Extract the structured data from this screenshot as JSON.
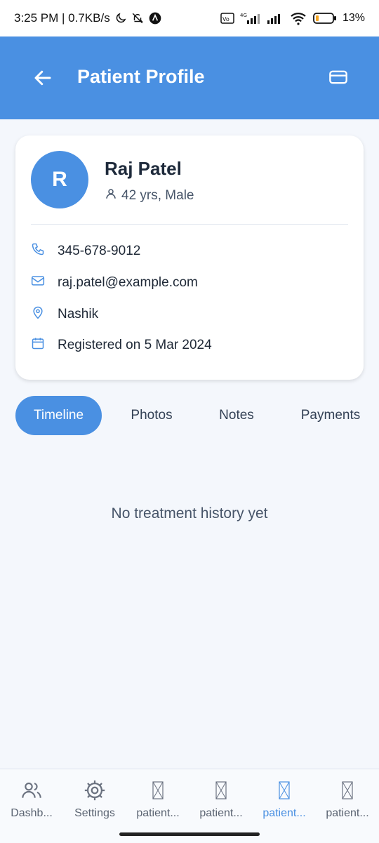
{
  "status_bar": {
    "time": "3:25 PM | 0.7KB/s",
    "network": "4G",
    "battery": "13%"
  },
  "app_bar": {
    "title": "Patient Profile"
  },
  "patient": {
    "initial": "R",
    "name": "Raj Patel",
    "meta": "42 yrs, Male",
    "phone": "345-678-9012",
    "email": "raj.patel@example.com",
    "location": "Nashik",
    "registered": "Registered on 5 Mar 2024"
  },
  "tabs": [
    {
      "label": "Timeline",
      "active": true
    },
    {
      "label": "Photos",
      "active": false
    },
    {
      "label": "Notes",
      "active": false
    },
    {
      "label": "Payments",
      "active": false
    }
  ],
  "empty_state": "No treatment history yet",
  "bottom_nav": [
    {
      "label": "Dashb...",
      "icon": "users-icon",
      "active": false
    },
    {
      "label": "Settings",
      "icon": "gear-icon",
      "active": false
    },
    {
      "label": "patient...",
      "icon": "broken-image-icon",
      "active": false
    },
    {
      "label": "patient...",
      "icon": "broken-image-icon",
      "active": false
    },
    {
      "label": "patient...",
      "icon": "broken-image-icon",
      "active": true
    },
    {
      "label": "patient...",
      "icon": "broken-image-icon",
      "active": false
    }
  ],
  "colors": {
    "primary": "#4a90e2",
    "background": "#f4f7fc",
    "text": "#1e293b"
  }
}
